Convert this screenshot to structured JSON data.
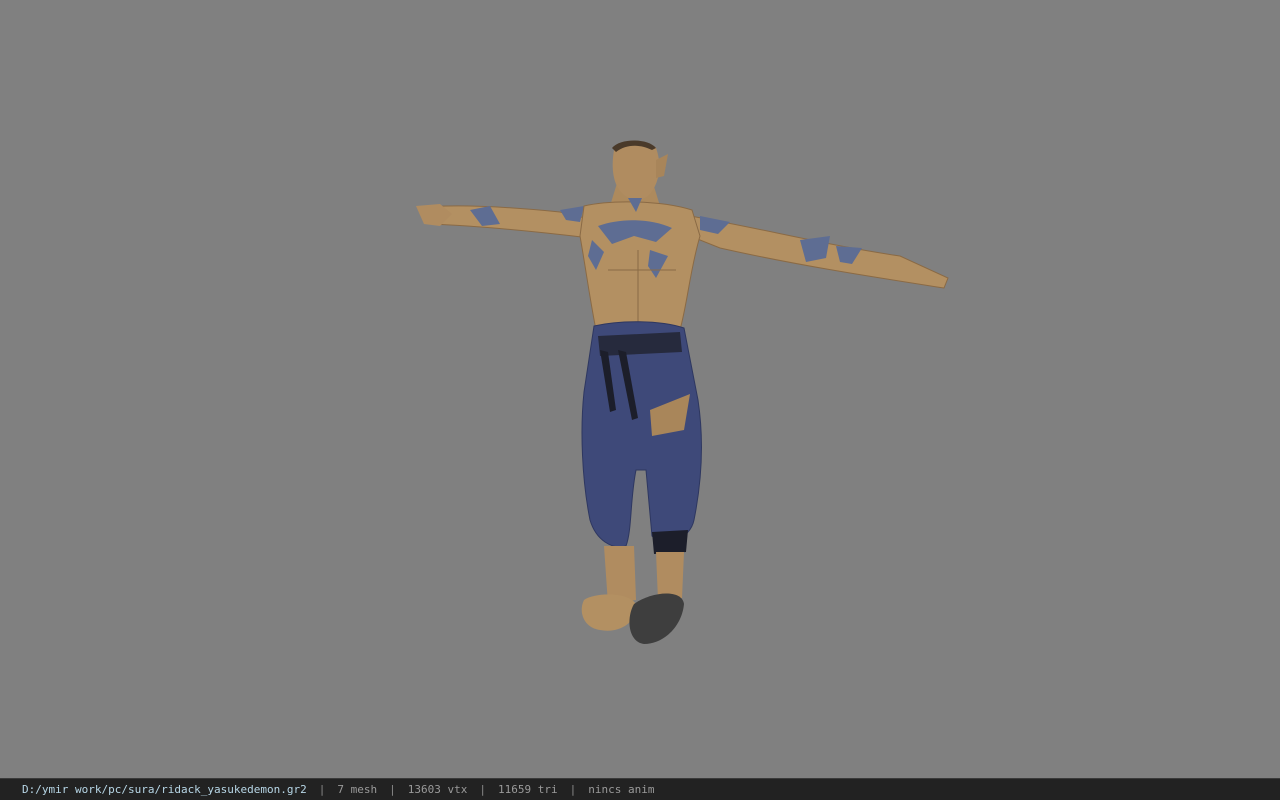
{
  "viewer": {
    "background_color": "#808080",
    "model_subject": "t-pose character model"
  },
  "status_bar": {
    "file_path": "D:/ymir work/pc/sura/ridack_yasukedemon.gr2",
    "separator": "|",
    "mesh_count": "7 mesh",
    "vertex_count": "13603 vtx",
    "triangle_count": "11659 tri",
    "anim_status": "nincs anim"
  }
}
